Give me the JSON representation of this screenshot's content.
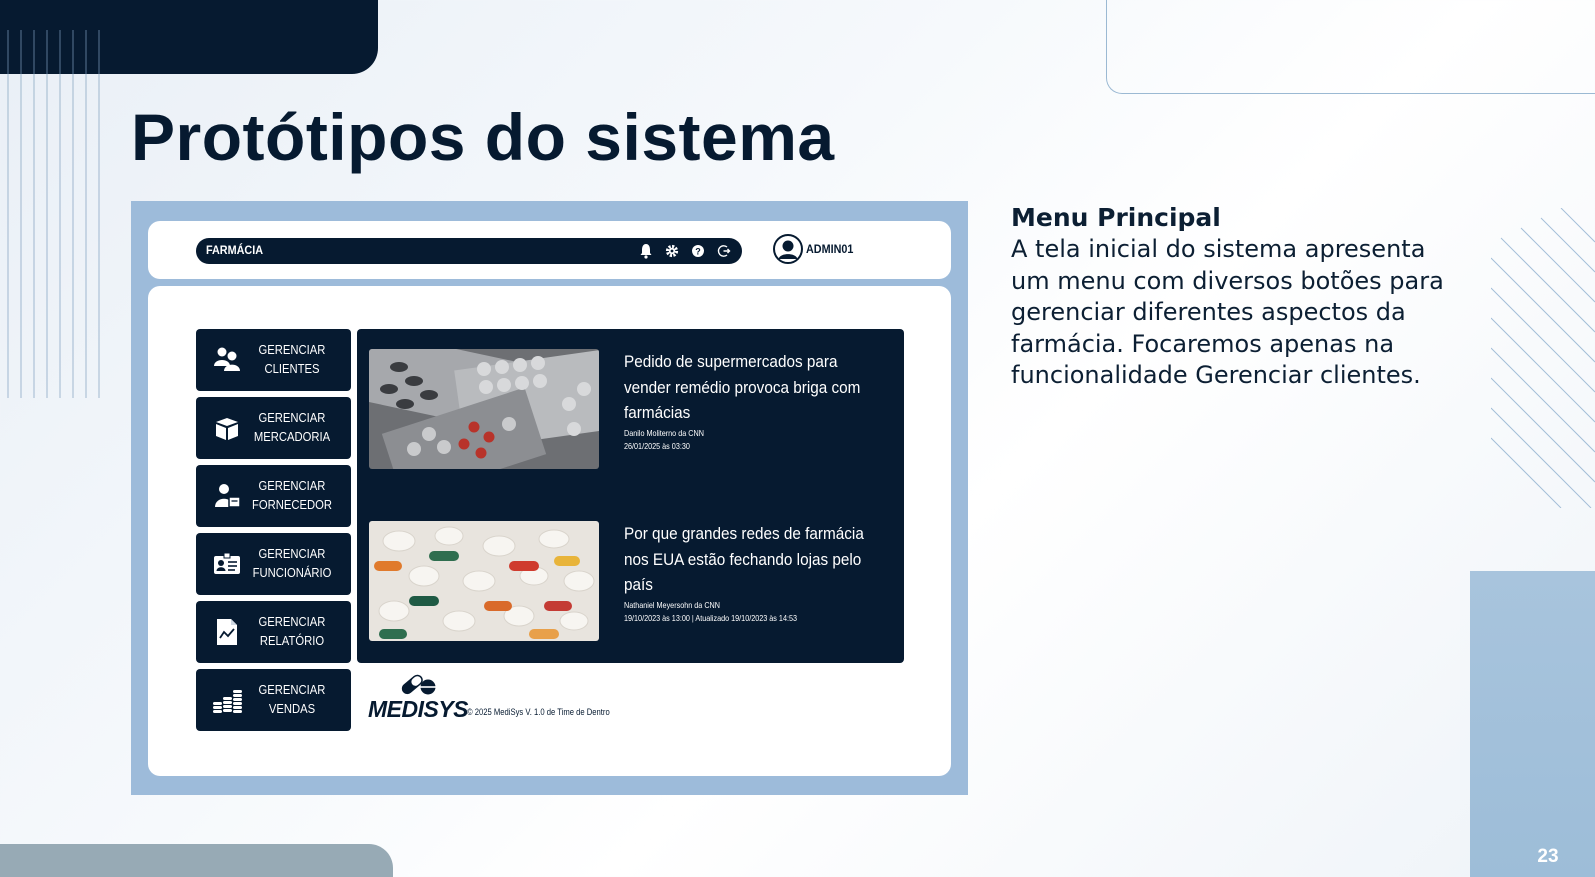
{
  "slide": {
    "title": "Protótipos do sistema",
    "page_number": "23"
  },
  "description": {
    "title": "Menu Principal",
    "body": "A tela inicial do sistema apresenta um menu com diversos botões para gerenciar diferentes aspectos da farmácia. Focaremos apenas na funcionalidade Gerenciar clientes."
  },
  "app": {
    "title": "FARMÁCIA",
    "nav_icons": [
      "bell-icon",
      "gear-icon",
      "help-icon",
      "logout-icon"
    ],
    "user": "ADMIN01",
    "menu": [
      {
        "label": "GERENCIAR\nCLIENTES",
        "icon": "users-icon"
      },
      {
        "label": "GERENCIAR\nMERCADORIA",
        "icon": "box-icon"
      },
      {
        "label": "GERENCIAR\nFORNECEDOR",
        "icon": "supplier-icon"
      },
      {
        "label": "GERENCIAR\nFUNCIONÁRIO",
        "icon": "id-card-icon"
      },
      {
        "label": "GERENCIAR\nRELATÓRIO",
        "icon": "report-icon"
      },
      {
        "label": "GERENCIAR\nVENDAS",
        "icon": "coins-icon"
      }
    ],
    "news": [
      {
        "title": "Pedido de supermercados para vender remédio provoca briga com farmácias",
        "author": "Danilo Moliterno da CNN",
        "date": "26/01/2025 às 03:30",
        "image": "pill-blister-photo"
      },
      {
        "title": "Por que grandes redes de farmácia nos EUA estão fechando lojas pelo país",
        "author": "Nathaniel Meyersohn da CNN",
        "date": "19/10/2023 às 13:00 | Atualizado 19/10/2023 às 14:53",
        "image": "assorted-pills-photo"
      }
    ],
    "logo": "MEDISYS",
    "copyright": "© 2025 MediSys V. 1.0 de Time de Dentro"
  },
  "colors": {
    "navy": "#061a30",
    "frame_blue": "#9dbbda",
    "accent_light": "#a8c4dd"
  }
}
